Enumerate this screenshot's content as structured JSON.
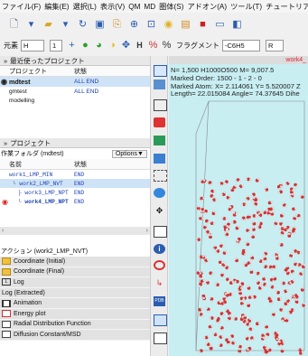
{
  "menu": [
    "ファイル(F)",
    "編集(E)",
    "選択(L)",
    "表示(V)",
    "QM",
    "MD",
    "圏体(S)",
    "アドオン(A)",
    "ツール(T)",
    "チュートリアル("
  ],
  "toolbar2": {
    "element_label": "元素",
    "element_value": "H",
    "element_arrow": "1",
    "fragment_label": "フラグメント",
    "fragment_value": "-C6H5",
    "r_label": "R"
  },
  "recent": {
    "title": "最近使ったプロジェクト",
    "col_project": "プロジェクト",
    "col_status": "状態",
    "rows": [
      {
        "name": "mdtest",
        "status": "ALL END"
      },
      {
        "name": "gmtest",
        "status": "ALL END"
      },
      {
        "name": "modelling",
        "status": ""
      }
    ]
  },
  "project": {
    "title": "プロジェクト",
    "folder": "作業フォルダ (mdtest)",
    "options": "Options▼",
    "col_name": "名前",
    "col_status": "状態",
    "rows": [
      {
        "name": "work1_LMP_MIN",
        "status": "END"
      },
      {
        "name": "└ work2_LMP_NVT",
        "status": "END"
      },
      {
        "name": "├ work3_LMP_NPT",
        "status": "END"
      },
      {
        "name": "└ work4_LMP_NPT",
        "status": "END"
      }
    ]
  },
  "actions": {
    "title": "アクション (work2_LMP_NVT)",
    "items": [
      {
        "label": "Coordinate (Initial)",
        "icon": "folder-icon"
      },
      {
        "label": "Coordinate (Final)",
        "icon": "folder-icon"
      },
      {
        "label": "Log",
        "icon": "log-icon"
      },
      {
        "label": "Log (Extracted)",
        "icon": "none"
      },
      {
        "label": "Animation",
        "icon": "film-icon"
      },
      {
        "label": "Energy plot",
        "icon": "graph-icon"
      },
      {
        "label": "Radial Distribution Function",
        "icon": "rdf-icon"
      },
      {
        "label": "Diffusion Constant/MSD",
        "icon": "msd-icon"
      }
    ]
  },
  "viewer": {
    "tab": "work4_",
    "info": [
      "N= 1,500  H1000O500  M= 9,007.5",
      "Marked Order: 1500 - 1 - 2 - 0",
      "Marked Atom: X= 2.114061 Y= 5.520007 Z",
      "Length= 22.015084 Angle= 74.37645 Dihe"
    ]
  },
  "colors": {
    "accent_blue": "#1a3fb3",
    "select": "#cfe3f7",
    "viewer_bg": "#c8eef2",
    "oxygen": "#d83030",
    "hydrogen": "#e8e8e8"
  }
}
